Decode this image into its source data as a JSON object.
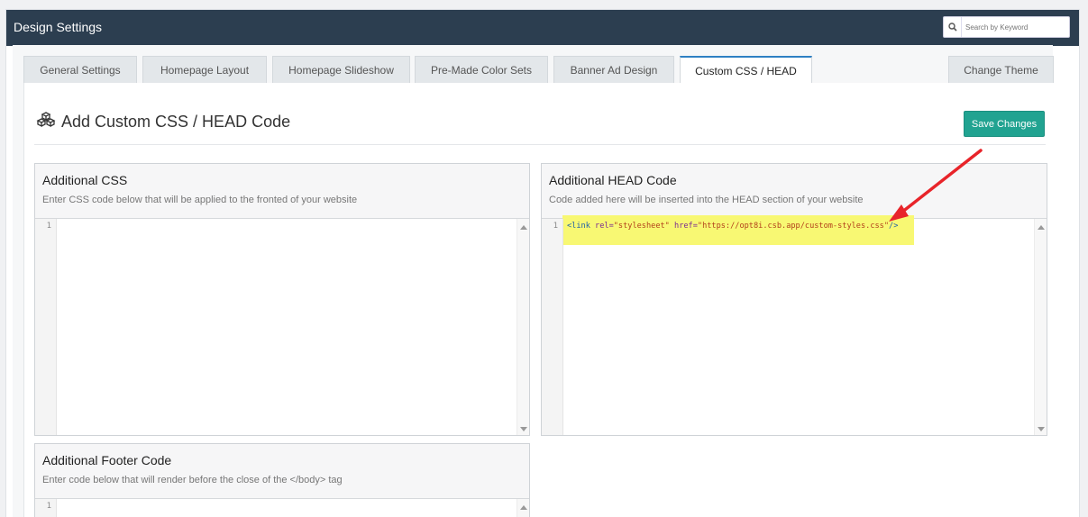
{
  "header": {
    "title": "Design Settings",
    "search_placeholder": "Search by Keyword"
  },
  "tabs": [
    {
      "label": "General Settings"
    },
    {
      "label": "Homepage Layout"
    },
    {
      "label": "Homepage Slideshow"
    },
    {
      "label": "Pre-Made Color Sets"
    },
    {
      "label": "Banner Ad Design"
    },
    {
      "label": "Custom CSS / HEAD"
    },
    {
      "label": "Change Theme"
    }
  ],
  "active_tab": "Custom CSS / HEAD",
  "page": {
    "heading": "Add Custom CSS / HEAD Code",
    "save_label": "Save Changes"
  },
  "sections": {
    "css": {
      "title": "Additional CSS",
      "description": "Enter CSS code below that will be applied to the fronted of your website",
      "line": "1"
    },
    "head": {
      "title": "Additional HEAD Code",
      "description": "Code added here will be inserted into the HEAD section of your website",
      "line": "1",
      "code": {
        "open": "<link",
        "attr1": " rel=",
        "val1": "\"stylesheet\"",
        "attr2": " href=",
        "val2": "\"https://opt8i.csb.app/custom-styles.css\"",
        "close": "/>"
      }
    },
    "footer": {
      "title": "Additional Footer Code",
      "description": "Enter code below that will render before the close of the </body> tag",
      "line": "1"
    }
  },
  "colors": {
    "topbar": "#2c3e50",
    "save_button": "#21a391",
    "active_tab_border": "#2f80c3",
    "highlight": "#f8f873",
    "arrow": "#e8242a"
  }
}
